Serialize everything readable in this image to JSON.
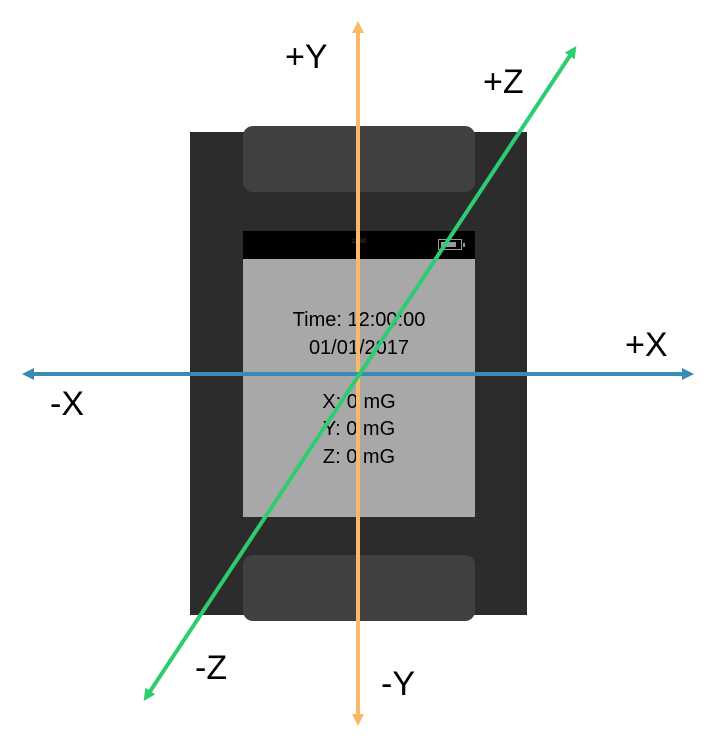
{
  "watch": {
    "status_time": "12:00",
    "battery_level": 0.85,
    "screen_lines": {
      "time": "Time: 12:00:00",
      "date": "01/01/2017",
      "x": "X: 0 mG",
      "y": "Y: 0 mG",
      "z": "Z: 0 mG"
    }
  },
  "axes": {
    "x": {
      "positive_label": "+X",
      "negative_label": "-X",
      "color": "#3a8ab7"
    },
    "y": {
      "positive_label": "+Y",
      "negative_label": "-Y",
      "color": "#f9b966"
    },
    "z": {
      "positive_label": "+Z",
      "negative_label": "-Z",
      "color": "#2ecc71"
    }
  },
  "colors": {
    "watch_body": "#2c2c2c",
    "band": "#404040",
    "screen": "#a8a8a8",
    "status_bar": "#000000"
  }
}
